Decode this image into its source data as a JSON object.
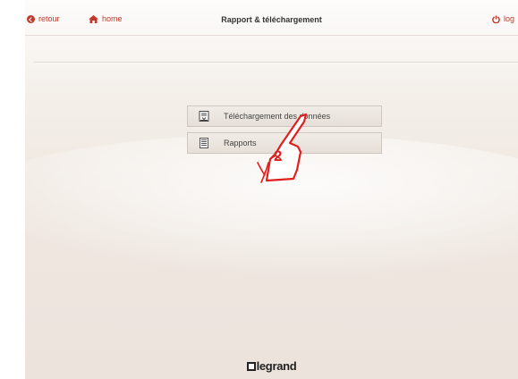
{
  "header": {
    "back_label": "retour",
    "home_label": "home",
    "title": "Rapport & téléchargement",
    "logout_label": "log"
  },
  "menu": {
    "items": [
      {
        "label": "Téléchargement des données",
        "icon": "download-document-icon"
      },
      {
        "label": "Rapports",
        "icon": "report-document-icon"
      }
    ]
  },
  "annotation": {
    "step": "2",
    "color": "#e0201f"
  },
  "footer": {
    "brand": "legrand"
  },
  "colors": {
    "accent": "#c0392b",
    "background": "#efe7e0"
  }
}
